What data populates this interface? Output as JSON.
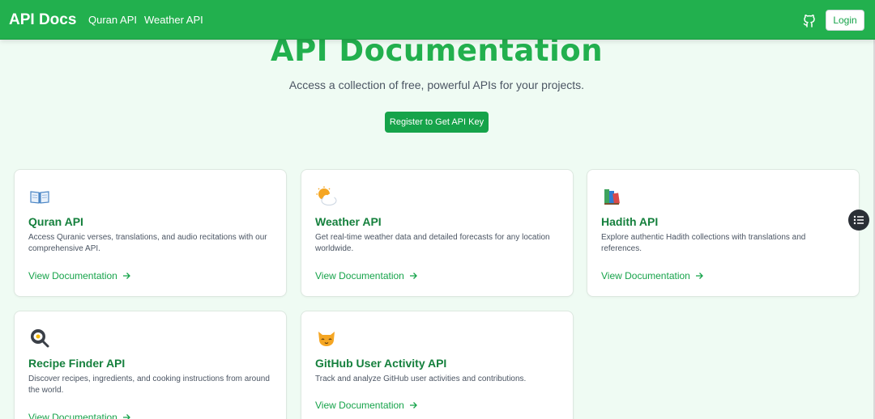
{
  "navbar": {
    "brand": "API Docs",
    "links": [
      "Quran API",
      "Weather API"
    ],
    "github_icon": "github-icon",
    "login_label": "Login"
  },
  "hero": {
    "title": "API Documentation",
    "subtitle": "Access a collection of free, powerful APIs for your projects.",
    "cta_label": "Register to Get API Key"
  },
  "cards": [
    {
      "icon": "open-book-icon",
      "title": "Quran API",
      "description": "Access Quranic verses, translations, and audio recitations with our comprehensive API.",
      "link": "View Documentation"
    },
    {
      "icon": "sun-behind-cloud-icon",
      "title": "Weather API",
      "description": "Get real-time weather data and detailed forecasts for any location worldwide.",
      "link": "View Documentation"
    },
    {
      "icon": "books-icon",
      "title": "Hadith API",
      "description": "Explore authentic Hadith collections with translations and references.",
      "link": "View Documentation"
    },
    {
      "icon": "frying-pan-icon",
      "title": "Recipe Finder API",
      "description": "Discover recipes, ingredients, and cooking instructions from around the world.",
      "link": "View Documentation"
    },
    {
      "icon": "cat-face-icon",
      "title": "GitHub User Activity API",
      "description": "Track and analyze GitHub user activities and contributions.",
      "link": "View Documentation"
    }
  ],
  "colors": {
    "nav_bg": "#22b04e",
    "accent": "#16a34a",
    "title_green": "#15803d",
    "page_bg": "#effbf3"
  }
}
